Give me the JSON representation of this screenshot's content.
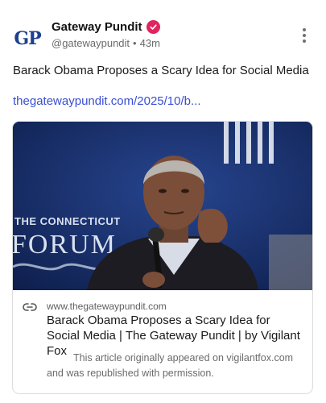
{
  "author": {
    "avatar_text": "GP",
    "display_name": "Gateway Pundit",
    "handle": "@gatewaypundit",
    "separator": "•",
    "time_ago": "43m",
    "verified": true
  },
  "post": {
    "text": "Barack Obama Proposes a Scary Idea for Social Media",
    "link_text": "thegatewaypundit.com/2025/10/b..."
  },
  "link_card": {
    "image_sign_line1": "THE CONNECTICUT",
    "image_sign_line2": "FORUM",
    "domain": "www.thegatewaypundit.com",
    "title": "Barack Obama Proposes a Scary Idea for Social Media | The Gateway Pundit | by Vigilant Fox",
    "description": "This article originally appeared on vigilantfox.com and was republished with permission."
  },
  "icons": {
    "verified": "verified-badge-icon",
    "more": "more-vertical-icon",
    "link": "link-icon"
  },
  "colors": {
    "link": "#3a4fd1",
    "verified": "#e0245e",
    "brand_blue": "#1d3f8f"
  }
}
